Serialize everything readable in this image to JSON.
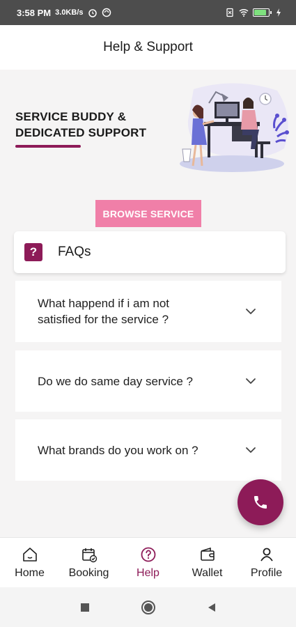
{
  "status_bar": {
    "time": "3:58 PM",
    "speed": "3.0KB/s",
    "icons": [
      "alarm-icon",
      "sync-icon",
      "sim-icon",
      "wifi-icon",
      "battery-icon",
      "charging-icon"
    ]
  },
  "header": {
    "title": "Help & Support"
  },
  "hero": {
    "title": "SERVICE BUDDY & DEDICATED SUPPORT",
    "illustration": "support-illustration"
  },
  "browse_button": {
    "label": "BROWSE SERVICE"
  },
  "faq": {
    "title": "FAQs",
    "icon_glyph": "?",
    "items": [
      {
        "question": "What happend if i am not satisfied for the service ?"
      },
      {
        "question": "Do we do same day service ?"
      },
      {
        "question": "What brands do you work on ?"
      }
    ]
  },
  "fab": {
    "icon": "phone-icon"
  },
  "bottom_nav": {
    "items": [
      {
        "label": "Home",
        "icon": "home-icon"
      },
      {
        "label": "Booking",
        "icon": "calendar-check-icon"
      },
      {
        "label": "Help",
        "icon": "help-circle-icon",
        "active": true
      },
      {
        "label": "Wallet",
        "icon": "wallet-icon"
      },
      {
        "label": "Profile",
        "icon": "user-icon"
      }
    ]
  },
  "colors": {
    "brand": "#8d1b58",
    "accent_pink": "#f07fa8",
    "background": "#f5f4f4"
  }
}
